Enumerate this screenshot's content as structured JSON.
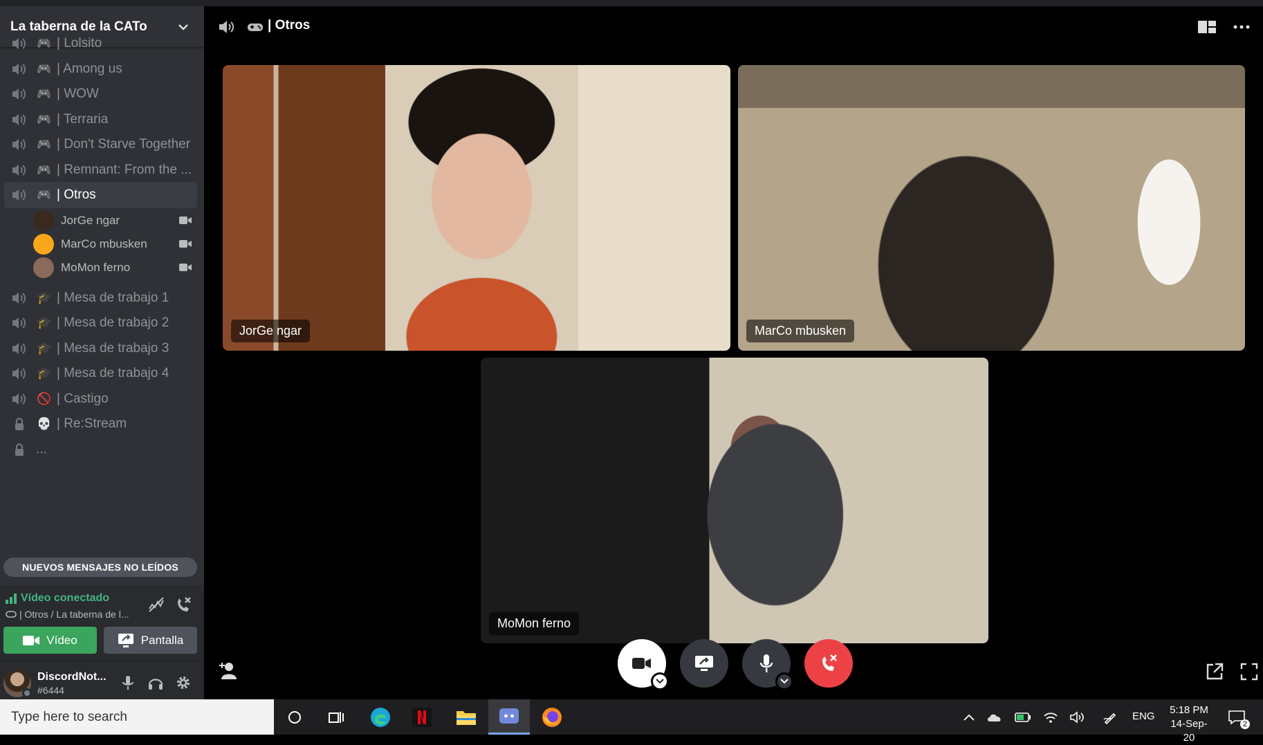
{
  "server": {
    "name": "La taberna de la CATo"
  },
  "channels": [
    {
      "name": "| Lolsito",
      "emoji": "🎮"
    },
    {
      "name": "| Among us",
      "emoji": "🎮"
    },
    {
      "name": "| WOW",
      "emoji": "🎮"
    },
    {
      "name": "| Terraria",
      "emoji": "🎮"
    },
    {
      "name": "| Don't Starve Together",
      "emoji": "🎮"
    },
    {
      "name": "| Remnant: From the ...",
      "emoji": "🎮"
    },
    {
      "name": "| Otros",
      "emoji": "🎮",
      "active": true
    },
    {
      "name": "| Mesa de trabajo 1",
      "emoji": "🎓"
    },
    {
      "name": "| Mesa de trabajo 2",
      "emoji": "🎓"
    },
    {
      "name": "| Mesa de trabajo 3",
      "emoji": "🎓"
    },
    {
      "name": "| Mesa de trabajo 4",
      "emoji": "🎓"
    },
    {
      "name": "| Castigo",
      "emoji": "🚫"
    },
    {
      "name": "| Re:Stream",
      "emoji": "💀",
      "locked": true
    },
    {
      "name": "...",
      "emoji": "",
      "locked": true
    }
  ],
  "members": [
    {
      "name": "JorGe ngar",
      "avatar_color": "#3a2a1e"
    },
    {
      "name": "MarCo mbusken",
      "avatar_color": "#faa61a"
    },
    {
      "name": "MoMon ferno",
      "avatar_color": "#8a6a5a"
    }
  ],
  "unread_banner": "NUEVOS MENSAJES NO LEÍDOS",
  "voice": {
    "status": "Vídeo conectado",
    "channel_path": "| Otros / La taberna de l...",
    "video_label": "Vídeo",
    "screen_label": "Pantalla"
  },
  "user": {
    "name": "DiscordNot...",
    "tag": "#6444"
  },
  "header": {
    "channel": "| Otros"
  },
  "tiles": [
    {
      "name": "JorGe ngar"
    },
    {
      "name": "MarCo mbusken"
    },
    {
      "name": "MoMon ferno"
    }
  ],
  "taskbar": {
    "search_placeholder": "Type here to search",
    "lang": "ENG",
    "time": "5:18 PM",
    "date": "14-Sep-20",
    "notif_count": "2"
  },
  "colors": {
    "sidebar": "#2f3136",
    "accent_green": "#43b581",
    "video_button": "#3ba55d",
    "hangup_red": "#ed4245"
  }
}
